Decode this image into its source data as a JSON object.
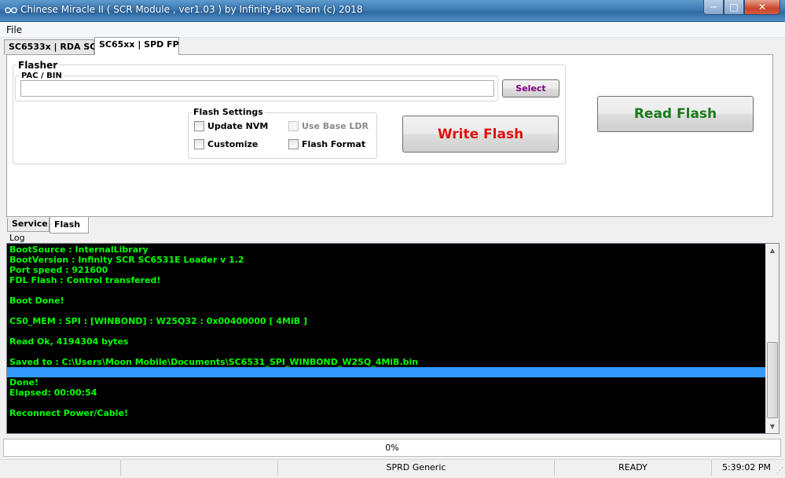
{
  "window": {
    "title": "Chinese Miracle II ( SCR Module , ver1.03  ) by Infinity-Box Team (c) 2018",
    "minimize_glyph": "─",
    "maximize_glyph": "□",
    "close_glyph": "✕"
  },
  "menu": {
    "file": "File"
  },
  "tabs": [
    {
      "label": "SC6533x | RDA SC"
    },
    {
      "label": "SC65xx | SPD FP"
    }
  ],
  "flasher": {
    "group_label": "Flasher",
    "pac_label": "PAC / BIN",
    "pac_value": "",
    "select_label": "Select",
    "write_label": "Write Flash",
    "read_label": "Read Flash",
    "settings_label": "Flash Settings",
    "checkboxes": [
      {
        "label": "Update NVM",
        "checked": false,
        "enabled": true
      },
      {
        "label": "Use Base LDR",
        "checked": false,
        "enabled": false
      },
      {
        "label": "Customize",
        "checked": false,
        "enabled": true
      },
      {
        "label": "Flash Format",
        "checked": false,
        "enabled": true
      }
    ]
  },
  "bottom_tabs": [
    {
      "label": "Service"
    },
    {
      "label": "Flash"
    }
  ],
  "log": {
    "label": "Log",
    "lines": [
      "BootSource  :  InternalLibrary",
      "BootVersion : Infinity SCR SC6531E Loader v 1.2",
      "Port speed : 921600",
      "FDL Flash  : Control transfered!",
      "",
      "Boot Done!",
      "",
      "CS0_MEM : SPI : [WINBOND] : W25Q32 : 0x00400000 [ 4MiB ]",
      "",
      "Read Ok, 4194304 bytes",
      "",
      "Saved to : C:\\Users\\Moon Mobile\\Documents\\SC6531_SPI_WINBOND_W25Q_4MiB.bin",
      "",
      "Done!",
      "Elapsed: 00:00:54",
      "",
      "Reconnect Power/Cable!"
    ],
    "selected_line": 12,
    "scroll_up_glyph": "▲",
    "scroll_down_glyph": "▼"
  },
  "progress": {
    "value": 0,
    "text": "0%"
  },
  "status": {
    "cell1": "",
    "cell2": "",
    "cell3": "SPRD Generic",
    "cell4": "READY",
    "time": "5:39:02 PM"
  },
  "colors": {
    "log_text": "#00ff00",
    "log_bg": "#000000",
    "selection": "#3399ff",
    "write_flash": "#e01010",
    "read_flash": "#1a7a1a",
    "select_button": "#800080"
  },
  "icons": {
    "app": "infinity-icon",
    "resize_grip": "resize-grip-icon"
  }
}
